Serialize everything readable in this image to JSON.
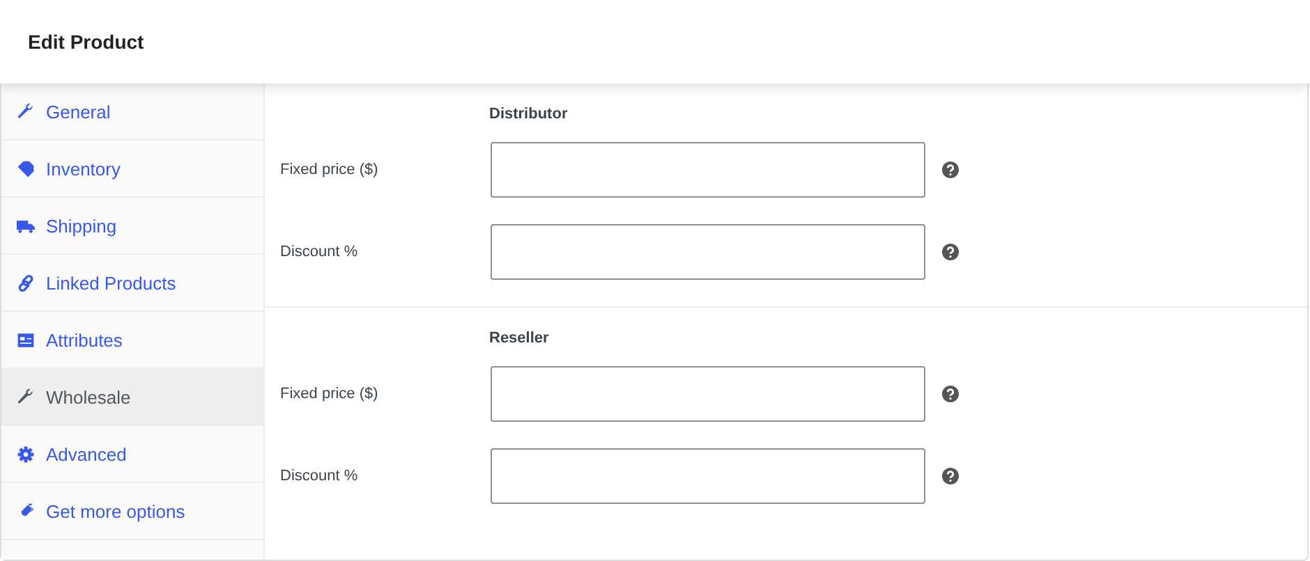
{
  "header": {
    "title": "Edit Product"
  },
  "tabs": [
    {
      "label": "General",
      "selected": false
    },
    {
      "label": "Inventory",
      "selected": false
    },
    {
      "label": "Shipping",
      "selected": false
    },
    {
      "label": "Linked Products",
      "selected": false
    },
    {
      "label": "Attributes",
      "selected": false
    },
    {
      "label": "Wholesale",
      "selected": true
    },
    {
      "label": "Advanced",
      "selected": false
    },
    {
      "label": "Get more options",
      "selected": false
    }
  ],
  "sections": [
    {
      "title": "Distributor",
      "fields": [
        {
          "label": "Fixed price ($)"
        },
        {
          "label": "Discount %"
        }
      ]
    },
    {
      "title": "Reseller",
      "fields": [
        {
          "label": "Fixed price ($)"
        },
        {
          "label": "Discount %"
        }
      ]
    }
  ]
}
